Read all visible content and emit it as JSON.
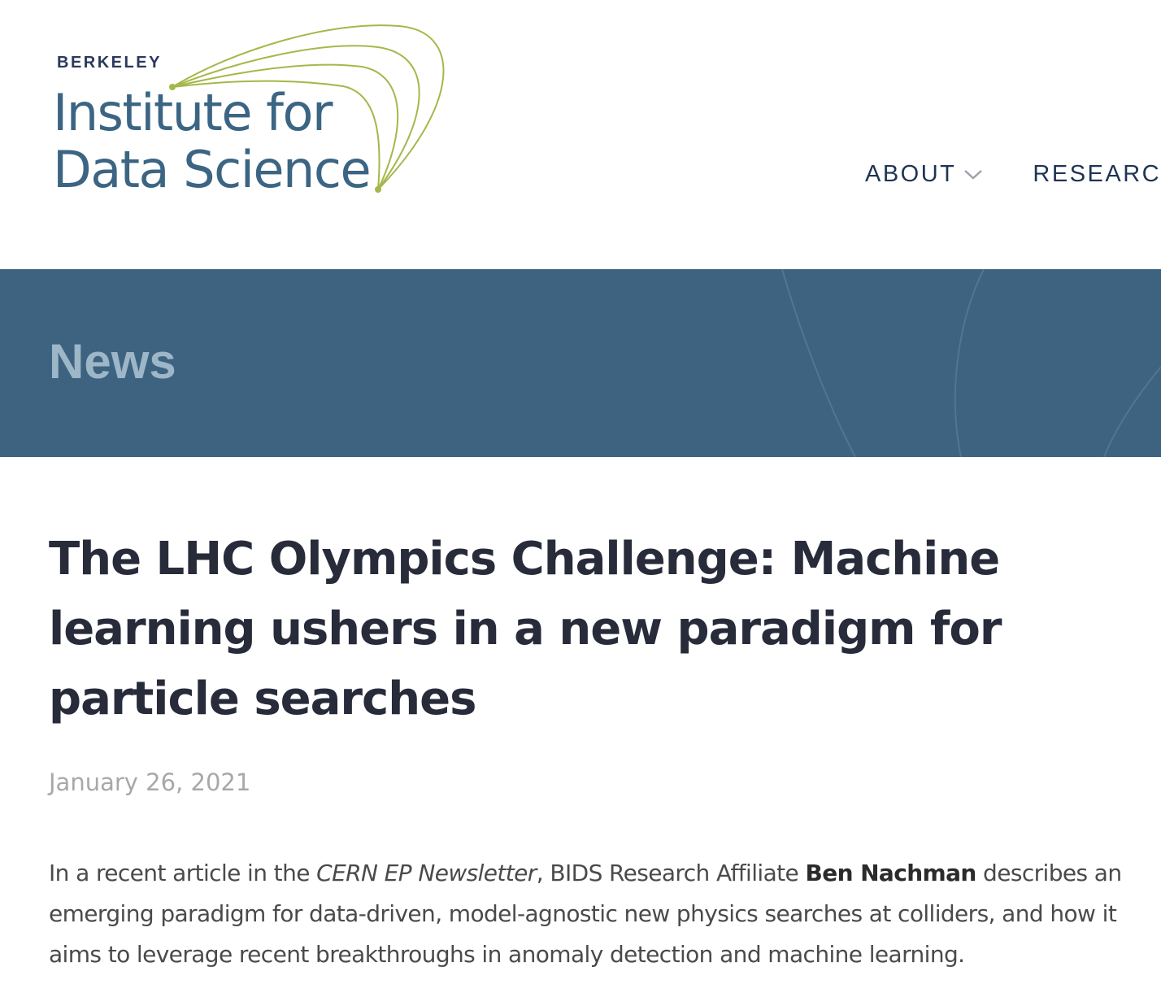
{
  "header": {
    "logo": {
      "org": "BERKELEY",
      "line1": "Institute for",
      "line2": "Data Science",
      "accent_color": "#a4b84a",
      "text_color": "#3b6583"
    },
    "nav": [
      {
        "label": "ABOUT",
        "icon": "chevron-down-icon"
      },
      {
        "label": "RESEARCH"
      }
    ]
  },
  "banner": {
    "title": "News",
    "background_color": "#3d6381"
  },
  "article": {
    "title": "The LHC Olympics Challenge: Machine learning ushers in a new paradigm for particle searches",
    "date": "January 26, 2021",
    "body": {
      "intro": "In a recent article in the ",
      "publication": "CERN EP Newsletter",
      "mid": ", BIDS Research Affiliate ",
      "person": "Ben Nachman",
      "rest": " describes an emerging paradigm for data-driven, model-agnostic new physics searches at colliders, and how it aims to leverage recent breakthroughs in anomaly detection and machine learning."
    }
  }
}
